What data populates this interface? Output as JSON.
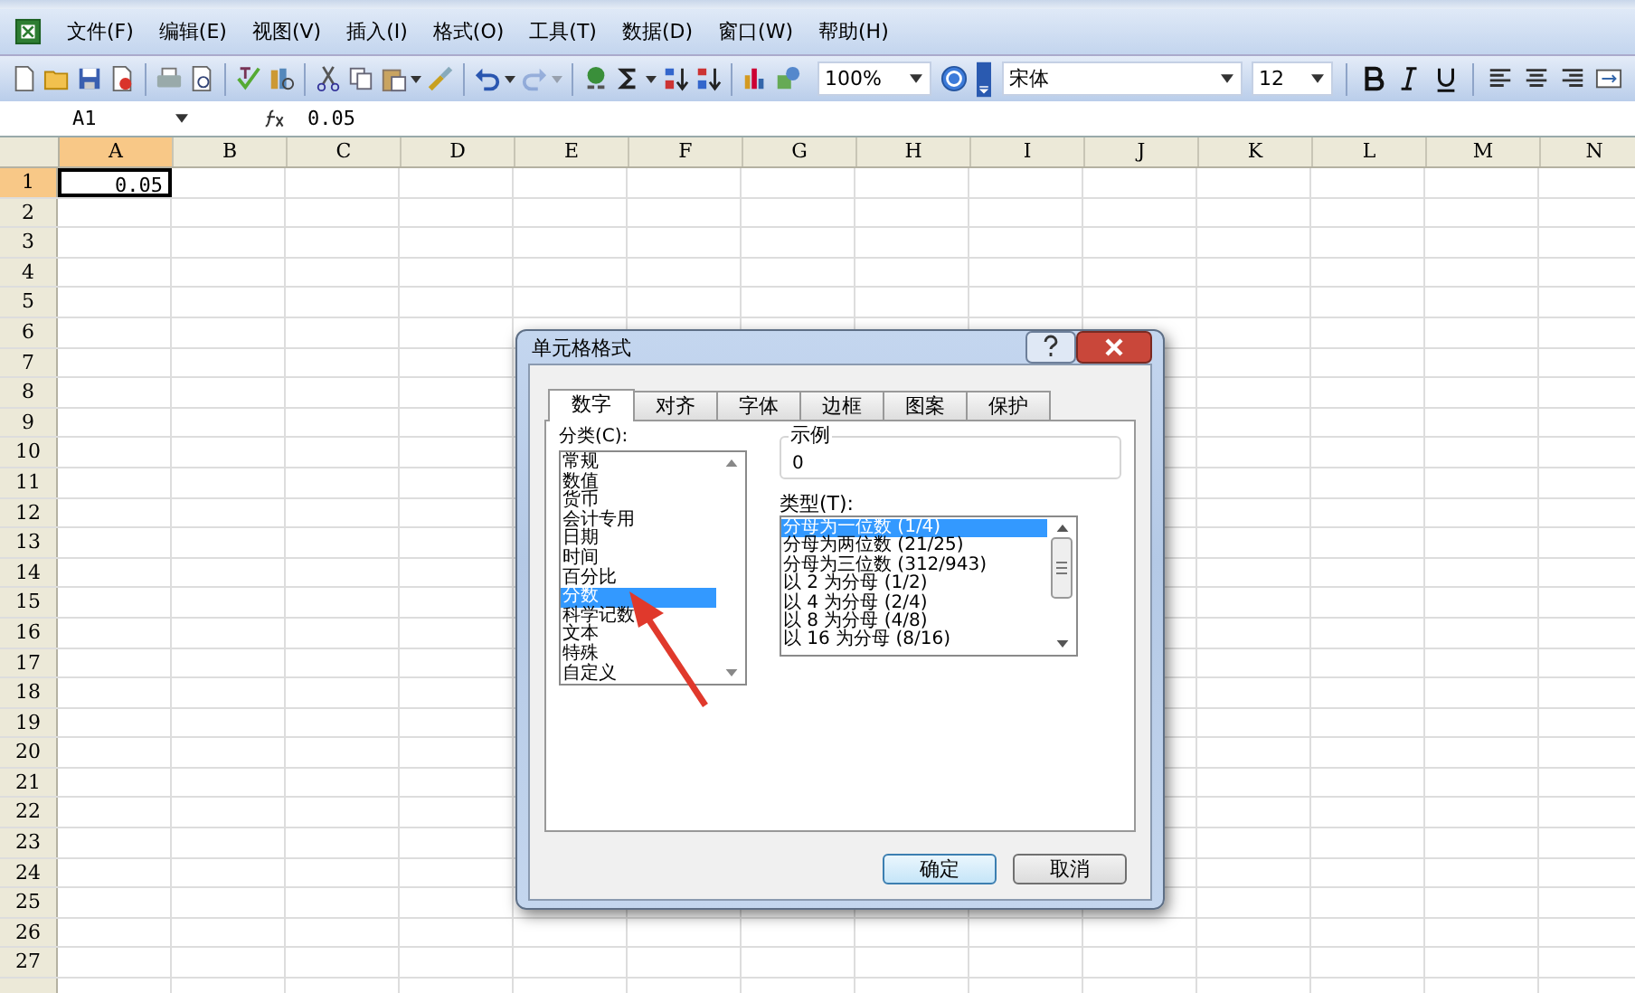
{
  "menu": [
    "文件(F)",
    "编辑(E)",
    "视图(V)",
    "插入(I)",
    "格式(O)",
    "工具(T)",
    "数据(D)",
    "窗口(W)",
    "帮助(H)"
  ],
  "toolbar": [
    {
      "kind": "new"
    },
    {
      "kind": "open"
    },
    {
      "kind": "save"
    },
    {
      "kind": "permission"
    },
    {
      "kind": "sep"
    },
    {
      "kind": "print"
    },
    {
      "kind": "preview"
    },
    {
      "kind": "sep"
    },
    {
      "kind": "spell"
    },
    {
      "kind": "research"
    },
    {
      "kind": "sep"
    },
    {
      "kind": "cut"
    },
    {
      "kind": "copy"
    },
    {
      "kind": "paste",
      "dropdown": true
    },
    {
      "kind": "painter"
    },
    {
      "kind": "sep"
    },
    {
      "kind": "undo",
      "dropdown": true
    },
    {
      "kind": "redo",
      "dropdown": true,
      "disabled": true
    },
    {
      "kind": "sep"
    },
    {
      "kind": "link"
    },
    {
      "kind": "sum",
      "dropdown": true
    },
    {
      "kind": "sortasc"
    },
    {
      "kind": "sortdesc"
    },
    {
      "kind": "sep"
    },
    {
      "kind": "chart"
    },
    {
      "kind": "drawing"
    }
  ],
  "zoom": "100%",
  "font": {
    "name": "宋体",
    "size": "12"
  },
  "format_buttons": [
    {
      "kind": "bold"
    },
    {
      "kind": "italic"
    },
    {
      "kind": "underline"
    },
    {
      "kind": "sep"
    },
    {
      "kind": "left"
    },
    {
      "kind": "center"
    },
    {
      "kind": "right"
    },
    {
      "kind": "merge"
    }
  ],
  "formula_bar": {
    "name_box": "A1",
    "value": "0.05"
  },
  "sheet": {
    "columns": [
      {
        "label": "A",
        "selected": true
      },
      {
        "label": "B",
        "selected": false
      },
      {
        "label": "C",
        "selected": false
      },
      {
        "label": "D",
        "selected": false
      },
      {
        "label": "E",
        "selected": false
      },
      {
        "label": "F",
        "selected": false
      },
      {
        "label": "G",
        "selected": false
      },
      {
        "label": "H",
        "selected": false
      },
      {
        "label": "I",
        "selected": false
      },
      {
        "label": "J",
        "selected": false
      },
      {
        "label": "K",
        "selected": false
      },
      {
        "label": "L",
        "selected": false
      },
      {
        "label": "M",
        "selected": false
      },
      {
        "label": "N",
        "selected": false
      }
    ],
    "rows": [
      {
        "label": "1",
        "selected": true,
        "cells": [
          {
            "value": "0.05",
            "selected": true
          }
        ]
      },
      {
        "label": "2",
        "selected": false
      },
      {
        "label": "3",
        "selected": false
      },
      {
        "label": "4",
        "selected": false
      },
      {
        "label": "5",
        "selected": false
      },
      {
        "label": "6",
        "selected": false
      },
      {
        "label": "7",
        "selected": false
      },
      {
        "label": "8",
        "selected": false
      },
      {
        "label": "9",
        "selected": false
      },
      {
        "label": "10",
        "selected": false
      },
      {
        "label": "11",
        "selected": false
      },
      {
        "label": "12",
        "selected": false
      },
      {
        "label": "13",
        "selected": false
      },
      {
        "label": "14",
        "selected": false
      },
      {
        "label": "15",
        "selected": false
      },
      {
        "label": "16",
        "selected": false
      },
      {
        "label": "17",
        "selected": false
      },
      {
        "label": "18",
        "selected": false
      },
      {
        "label": "19",
        "selected": false
      },
      {
        "label": "20",
        "selected": false
      },
      {
        "label": "21",
        "selected": false
      },
      {
        "label": "22",
        "selected": false
      },
      {
        "label": "23",
        "selected": false
      },
      {
        "label": "24",
        "selected": false
      },
      {
        "label": "25",
        "selected": false
      },
      {
        "label": "26",
        "selected": false
      },
      {
        "label": "27",
        "selected": false
      },
      {
        "selected": false
      }
    ]
  },
  "dialog": {
    "title": "单元格格式",
    "tabs": [
      {
        "label": "数字",
        "selected": true
      },
      {
        "label": "对齐",
        "selected": false
      },
      {
        "label": "字体",
        "selected": false
      },
      {
        "label": "边框",
        "selected": false
      },
      {
        "label": "图案",
        "selected": false
      },
      {
        "label": "保护",
        "selected": false
      }
    ],
    "category_label": "分类(C):",
    "categories": [
      {
        "label": "常规",
        "selected": false
      },
      {
        "label": "数值",
        "selected": false
      },
      {
        "label": "货币",
        "selected": false
      },
      {
        "label": "会计专用",
        "selected": false
      },
      {
        "label": "日期",
        "selected": false
      },
      {
        "label": "时间",
        "selected": false
      },
      {
        "label": "百分比",
        "selected": false
      },
      {
        "label": "分数",
        "selected": true
      },
      {
        "label": "科学记数",
        "selected": false
      },
      {
        "label": "文本",
        "selected": false
      },
      {
        "label": "特殊",
        "selected": false
      },
      {
        "label": "自定义",
        "selected": false
      }
    ],
    "sample_label": "示例",
    "sample_value": "0",
    "type_label": "类型(T):",
    "types": [
      {
        "label": "分母为一位数 (1/4)",
        "selected": true
      },
      {
        "label": "分母为两位数 (21/25)",
        "selected": false
      },
      {
        "label": "分母为三位数 (312/943)",
        "selected": false
      },
      {
        "label": "以 2 为分母 (1/2)",
        "selected": false
      },
      {
        "label": "以 4 为分母 (2/4)",
        "selected": false
      },
      {
        "label": "以 8 为分母 (4/8)",
        "selected": false
      },
      {
        "label": "以 16 为分母 (8/16)",
        "selected": false
      }
    ],
    "buttons": [
      "确定",
      "取消"
    ]
  },
  "annotation": {
    "kind": "arrow"
  }
}
